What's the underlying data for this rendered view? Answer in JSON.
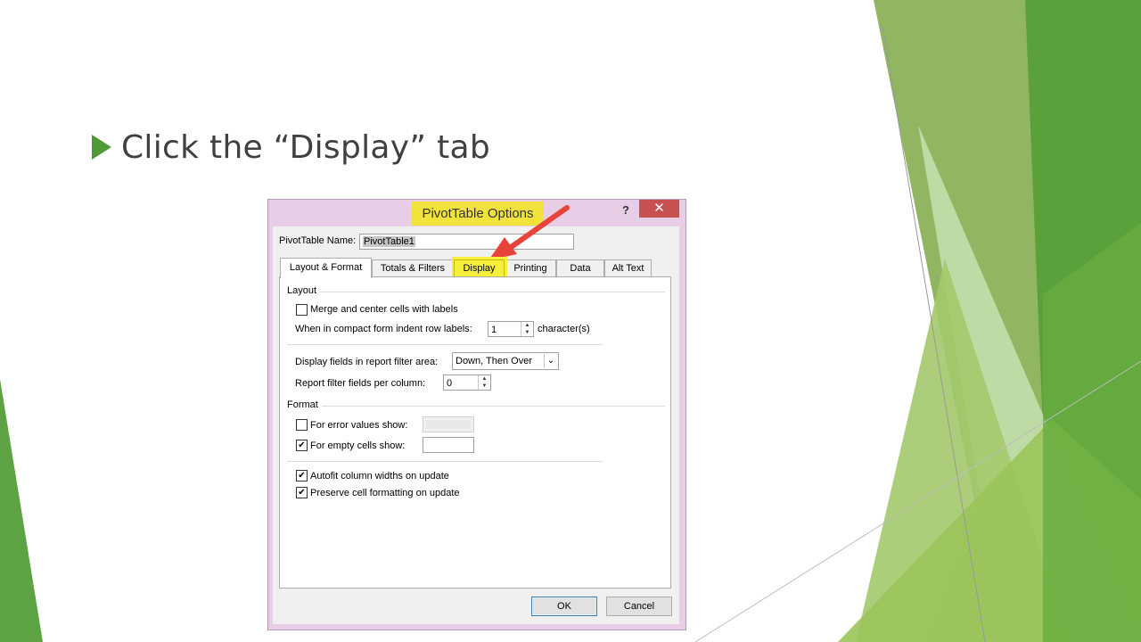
{
  "slide": {
    "bullet_text": "Click the “Display” tab"
  },
  "dialog": {
    "title": "PivotTable Options",
    "help_label": "?",
    "close_label": "✕",
    "name_label": "PivotTable Name:",
    "name_value": "PivotTable1",
    "tabs": [
      {
        "label": "Layout & Format",
        "active": true
      },
      {
        "label": "Totals & Filters",
        "active": false
      },
      {
        "label": "Display",
        "active": false
      },
      {
        "label": "Printing",
        "active": false
      },
      {
        "label": "Data",
        "active": false
      },
      {
        "label": "Alt Text",
        "active": false
      }
    ],
    "layout_group": {
      "title": "Layout",
      "merge_label": "Merge and center cells with labels",
      "merge_checked": false,
      "indent_label": "When in compact form indent row labels:",
      "indent_value": "1",
      "indent_unit": "character(s)",
      "display_fields_label": "Display fields in report filter area:",
      "display_fields_value": "Down, Then Over",
      "fields_per_column_label": "Report filter fields per column:",
      "fields_per_column_value": "0"
    },
    "format_group": {
      "title": "Format",
      "error_label": "For error values show:",
      "error_checked": false,
      "empty_label": "For empty cells show:",
      "empty_checked": true,
      "autofit_label": "Autofit column widths on update",
      "autofit_checked": true,
      "preserve_label": "Preserve cell formatting on update",
      "preserve_checked": true
    },
    "buttons": {
      "ok": "OK",
      "cancel": "Cancel"
    },
    "check_glyph": "✔"
  },
  "colors": {
    "accent_green": "#4f9a36",
    "highlight_yellow": "#f5ef3a",
    "arrow_red": "#e8433a",
    "dialog_border": "#e8cde6"
  }
}
